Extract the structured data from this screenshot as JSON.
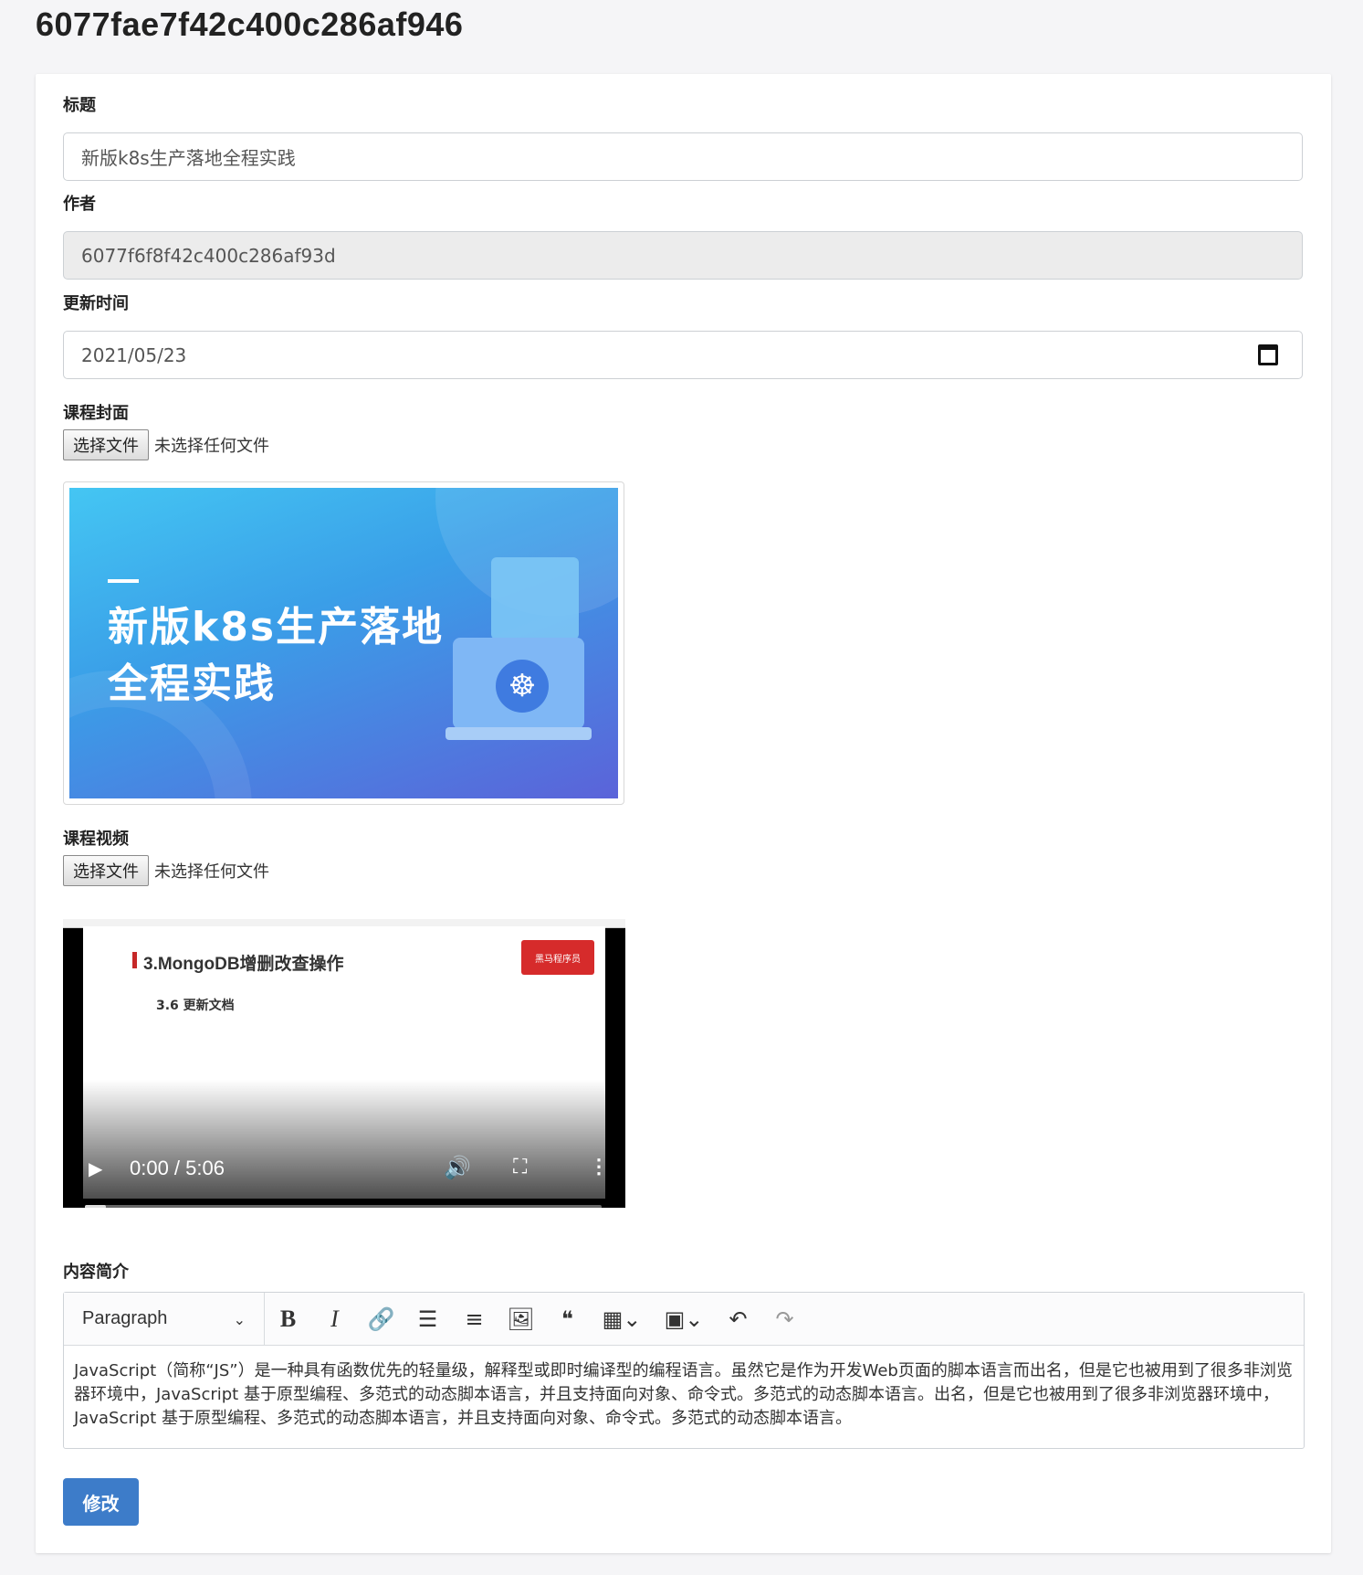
{
  "page": {
    "title": "6077fae7f42c400c286af946"
  },
  "form": {
    "title_label": "标题",
    "title_value": "新版k8s生产落地全程实践",
    "author_label": "作者",
    "author_value": "6077f6f8f42c400c286af93d",
    "updated_label": "更新时间",
    "updated_value": "2021/05/23",
    "cover_label": "课程封面",
    "cover_file_button": "选择文件",
    "cover_file_status": "未选择任何文件",
    "cover_image_text": [
      "新版k8s生产落地",
      "全程实践"
    ],
    "video_label": "课程视频",
    "video_file_button": "选择文件",
    "video_file_status": "未选择任何文件",
    "video": {
      "slide_heading": "3.MongoDB增删改查操作",
      "slide_subheading": "3.6 更新文档",
      "logo_text": "黑马程序员",
      "time": "0:00 / 5:06",
      "progress": 0.04
    },
    "intro_label": "内容简介",
    "editor": {
      "format_select": "Paragraph",
      "toolbar_icons": [
        "bold-icon",
        "italic-icon",
        "link-icon",
        "bulleted-list-icon",
        "numbered-list-icon",
        "image-icon",
        "blockquote-icon",
        "table-icon",
        "media-icon",
        "undo-icon",
        "redo-icon"
      ],
      "content": "JavaScript（简称“JS”）是一种具有函数优先的轻量级，解释型或即时编译型的编程语言。虽然它是作为开发Web页面的脚本语言而出名，但是它也被用到了很多非浏览器环境中，JavaScript 基于原型编程、多范式的动态脚本语言，并且支持面向对象、命令式。多范式的动态脚本语言。出名，但是它也被用到了很多非浏览器环境中，JavaScript 基于原型编程、多范式的动态脚本语言，并且支持面向对象、命令式。多范式的动态脚本语言。"
    },
    "submit_label": "修改"
  },
  "colors": {
    "primary": "#3d7cc9",
    "disabled_bg": "#ececec",
    "page_bg": "#f5f5f7"
  }
}
